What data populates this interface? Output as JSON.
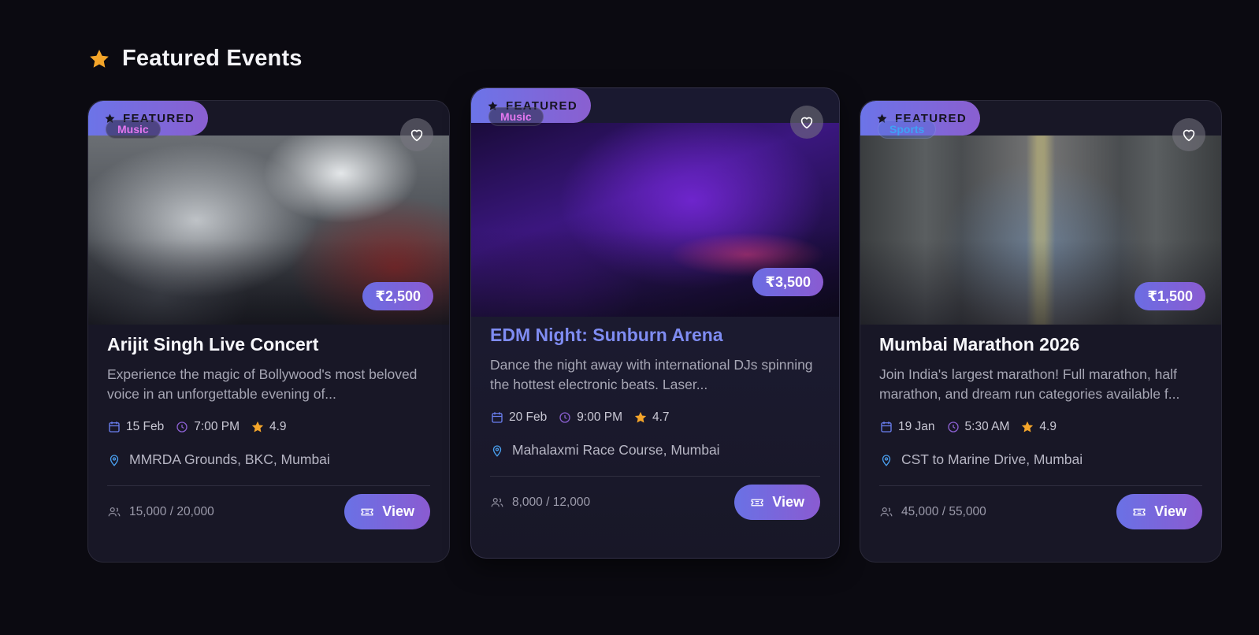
{
  "section": {
    "title": "Featured Events",
    "icon": "star-icon"
  },
  "badge_label": "FEATURED",
  "colors": {
    "accent": "#6c74e8",
    "accent2": "#8a5fd0",
    "background": "#0b0a11",
    "card": "#181726",
    "star": "#f4a52a",
    "music": "#e477ef",
    "sports": "#3fa2f5"
  },
  "events": [
    {
      "category": "Music",
      "price": "₹2,500",
      "title": "Arijit Singh Live Concert",
      "description": "Experience the magic of Bollywood's most beloved voice in an unforgettable evening of...",
      "date": "15 Feb",
      "time": "7:00 PM",
      "rating": "4.9",
      "location": "MMRDA Grounds, BKC, Mumbai",
      "capacity": "15,000 / 20,000",
      "view_label": "View"
    },
    {
      "category": "Music",
      "price": "₹3,500",
      "title": "EDM Night: Sunburn Arena",
      "description": "Dance the night away with international DJs spinning the hottest electronic beats. Laser...",
      "date": "20 Feb",
      "time": "9:00 PM",
      "rating": "4.7",
      "location": "Mahalaxmi Race Course, Mumbai",
      "capacity": "8,000 / 12,000",
      "view_label": "View"
    },
    {
      "category": "Sports",
      "price": "₹1,500",
      "title": "Mumbai Marathon 2026",
      "description": "Join India's largest marathon! Full marathon, half marathon, and dream run categories available f...",
      "date": "19 Jan",
      "time": "5:30 AM",
      "rating": "4.9",
      "location": "CST to Marine Drive, Mumbai",
      "capacity": "45,000 / 55,000",
      "view_label": "View"
    }
  ]
}
